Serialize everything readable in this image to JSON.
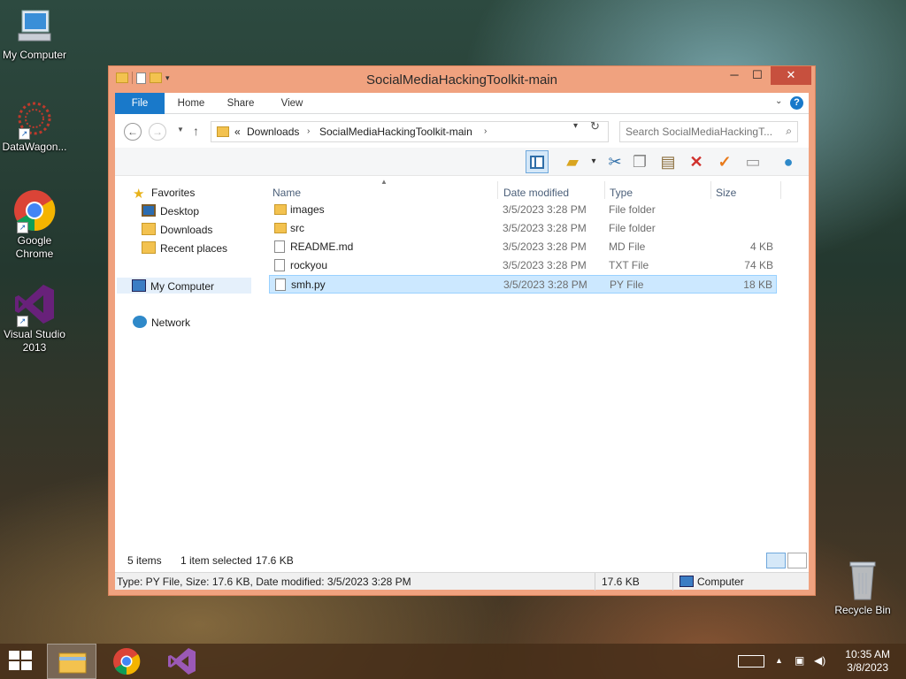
{
  "desktop": {
    "icons": [
      {
        "label": "My Computer"
      },
      {
        "label": "DataWagon..."
      },
      {
        "label": "Google Chrome"
      },
      {
        "label": "Visual Studio 2013"
      },
      {
        "label": "Recycle Bin"
      }
    ]
  },
  "window": {
    "title": "SocialMediaHackingToolkit-main",
    "controls": {
      "minimize": "─",
      "maximize": "☐",
      "close": "✕"
    },
    "ribbon": {
      "tabs": [
        "File",
        "Home",
        "Share",
        "View"
      ],
      "expand": "⌄",
      "help": "?"
    },
    "address": {
      "back": "←",
      "forward": "→",
      "overflow": "«",
      "crumbs": [
        "Downloads",
        "SocialMediaHackingToolkit-main"
      ],
      "search_placeholder": "Search SocialMediaHackingT..."
    },
    "nav": {
      "favorites": "Favorites",
      "desktop": "Desktop",
      "downloads": "Downloads",
      "recent": "Recent places",
      "computer": "My Computer",
      "network": "Network"
    },
    "columns": {
      "name": "Name",
      "date": "Date modified",
      "type": "Type",
      "size": "Size"
    },
    "files": [
      {
        "name": "images",
        "date": "3/5/2023 3:28 PM",
        "type": "File folder",
        "size": "",
        "icon": "folder"
      },
      {
        "name": "src",
        "date": "3/5/2023 3:28 PM",
        "type": "File folder",
        "size": "",
        "icon": "folder"
      },
      {
        "name": "README.md",
        "date": "3/5/2023 3:28 PM",
        "type": "MD File",
        "size": "4 KB",
        "icon": "doc"
      },
      {
        "name": "rockyou",
        "date": "3/5/2023 3:28 PM",
        "type": "TXT File",
        "size": "74 KB",
        "icon": "doc"
      },
      {
        "name": "smh.py",
        "date": "3/5/2023 3:28 PM",
        "type": "PY File",
        "size": "18 KB",
        "icon": "doc",
        "selected": true
      }
    ],
    "status": {
      "count": "5 items",
      "selection": "1 item selected",
      "selection_size": "17.6 KB"
    },
    "info": {
      "details": "Type: PY File, Size: 17.6 KB, Date modified: 3/5/2023 3:28 PM",
      "size": "17.6 KB",
      "location": "Computer"
    }
  },
  "taskbar": {
    "clock_time": "10:35 AM",
    "clock_date": "3/8/2023"
  },
  "colors": {
    "window_frame": "#f0a27f",
    "file_tab": "#1979ca",
    "close_button": "#c7503e",
    "selection": "#cce8ff"
  }
}
